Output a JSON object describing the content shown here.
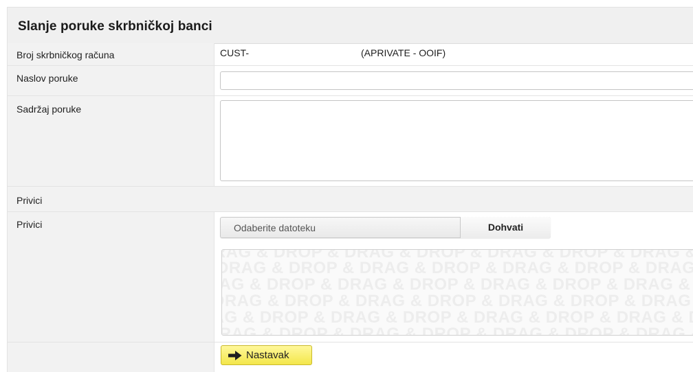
{
  "page": {
    "title": "Slanje poruke skrbničkoj banci"
  },
  "form": {
    "account": {
      "label": "Broj skrbničkog računa",
      "number": "CUST-",
      "name": "(APRIVATE - OOIF)"
    },
    "subject": {
      "label": "Naslov poruke",
      "value": ""
    },
    "content": {
      "label": "Sadržaj poruke",
      "value": ""
    },
    "attachments_heading": {
      "label": "Privici"
    },
    "attachments": {
      "label": "Privici",
      "file_placeholder": "Odaberite datoteku",
      "fetch_label": "Dohvati",
      "drop_text": "DRAG & DROP & DRAG & DROP & DRAG & DROP & DRAG & DROP & DRAG & DROP"
    }
  },
  "actions": {
    "continue_label": "Nastavak",
    "continue_icon": "arrow-right-icon"
  },
  "colors": {
    "continue_button": "#f5ea55",
    "label_background": "#f2f2f2",
    "title_background": "#f0f0f0"
  }
}
